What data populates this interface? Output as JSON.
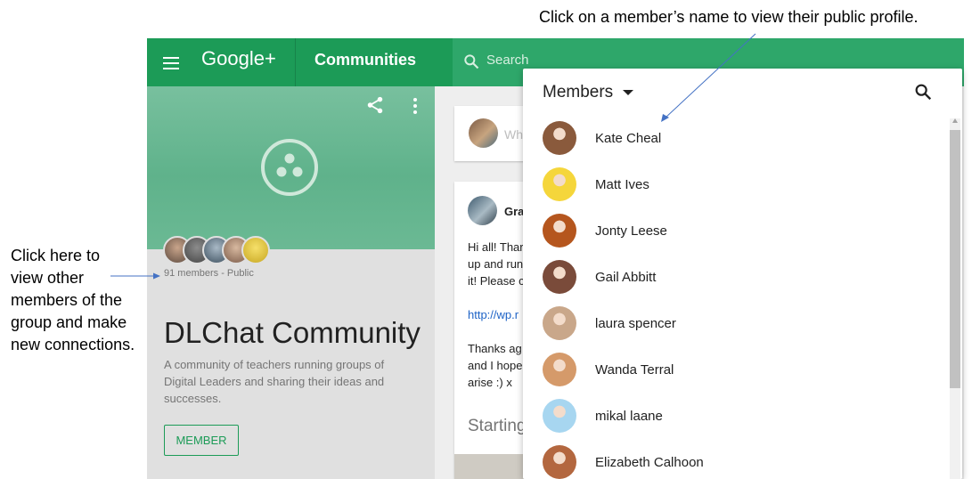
{
  "annotations": {
    "top": "Click on a member’s name to view their public profile.",
    "left": "Click here to view other members of the group and make new connections."
  },
  "topbar": {
    "brand": "Google+",
    "section": "Communities",
    "search_placeholder": "Search"
  },
  "community": {
    "meta": "91 members - Public",
    "title": "DLChat Community",
    "description": "A community of teachers running groups of Digital Leaders and sharing their ideas and successes.",
    "member_button": "MEMBER"
  },
  "stream": {
    "write_placeholder": "Wh",
    "post_author": "Gra",
    "post_lines": [
      "Hi all! Thar",
      "up and run",
      "it! Please c"
    ],
    "post_link": "http://wp.r",
    "post_lines2": [
      "Thanks ag",
      "and I hope",
      "arise :) x"
    ],
    "section_label": "Starting"
  },
  "members_panel": {
    "title": "Members",
    "members": [
      {
        "name": "Kate Cheal",
        "avatar_color": "#8a5a3c"
      },
      {
        "name": "Matt Ives",
        "avatar_color": "#f5d63b"
      },
      {
        "name": "Jonty Leese",
        "avatar_color": "#b5561e"
      },
      {
        "name": "Gail Abbitt",
        "avatar_color": "#7a4b3a"
      },
      {
        "name": "laura spencer",
        "avatar_color": "#c9a78a"
      },
      {
        "name": "Wanda Terral",
        "avatar_color": "#d59a6a"
      },
      {
        "name": "mikal laane",
        "avatar_color": "#a7d6f0"
      },
      {
        "name": "Elizabeth Calhoon",
        "avatar_color": "#b3673f"
      }
    ]
  },
  "colors": {
    "brand_green": "#1c9b57",
    "link_blue": "#1e63c6"
  }
}
